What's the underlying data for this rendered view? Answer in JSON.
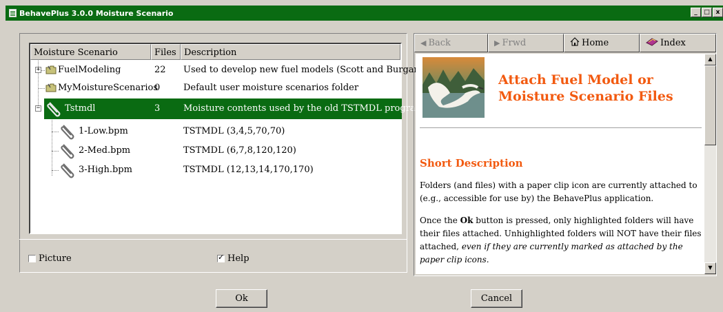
{
  "window": {
    "title": "BehavePlus 3.0.0 Moisture Scenario",
    "buttons": {
      "minimize": "_",
      "maximize": "□",
      "close": "x"
    }
  },
  "tree": {
    "columns": [
      "Moisture Scenario",
      "Files",
      "Description"
    ],
    "rows": [
      {
        "name": "FuelModeling",
        "files": "22",
        "description": "Used to develop new fuel models (Scott and Burgan)",
        "expander": "+"
      },
      {
        "name": "MyMoistureScenarios",
        "files": "0",
        "description": "Default user moisture scenarios folder"
      },
      {
        "name": "Tstmdl",
        "files": "3",
        "description": "Moisture contents used by the old TSTMDL program.",
        "expander": "−"
      },
      {
        "name": "1-Low.bpm",
        "files": "",
        "description": "TSTMDL (3,4,5,70,70)"
      },
      {
        "name": "2-Med.bpm",
        "files": "",
        "description": "TSTMDL (6,7,8,120,120)"
      },
      {
        "name": "3-High.bpm",
        "files": "",
        "description": "TSTMDL (12,13,14,170,170)"
      }
    ]
  },
  "options": {
    "picture_label": "Picture",
    "picture_checked": false,
    "help_label": "Help",
    "help_checked": true
  },
  "help_nav": {
    "back": "Back",
    "forward": "Frwd",
    "home": "Home",
    "index": "Index"
  },
  "help": {
    "title": "Attach Fuel Model or Moisture Scenario Files",
    "section_heading": "Short Description",
    "para1": "Folders (and files) with a paper clip icon are currently attached to (e.g., accessible for use by) the BehavePlus application.",
    "para2_start": "Once the ",
    "para2_bold": "Ok",
    "para2_rest": " button is pressed, only highlighted folders will have their files attached. Unhighlighted folders will NOT have their files attached, ",
    "para2_italic": "even if they are currently marked as attached by the paper clip icons."
  },
  "footer": {
    "ok": "Ok",
    "cancel": "Cancel"
  },
  "colors": {
    "selection": "#0a6b12",
    "accent_title": "#f25a10",
    "dialog_bg": "#d4d0c8"
  }
}
